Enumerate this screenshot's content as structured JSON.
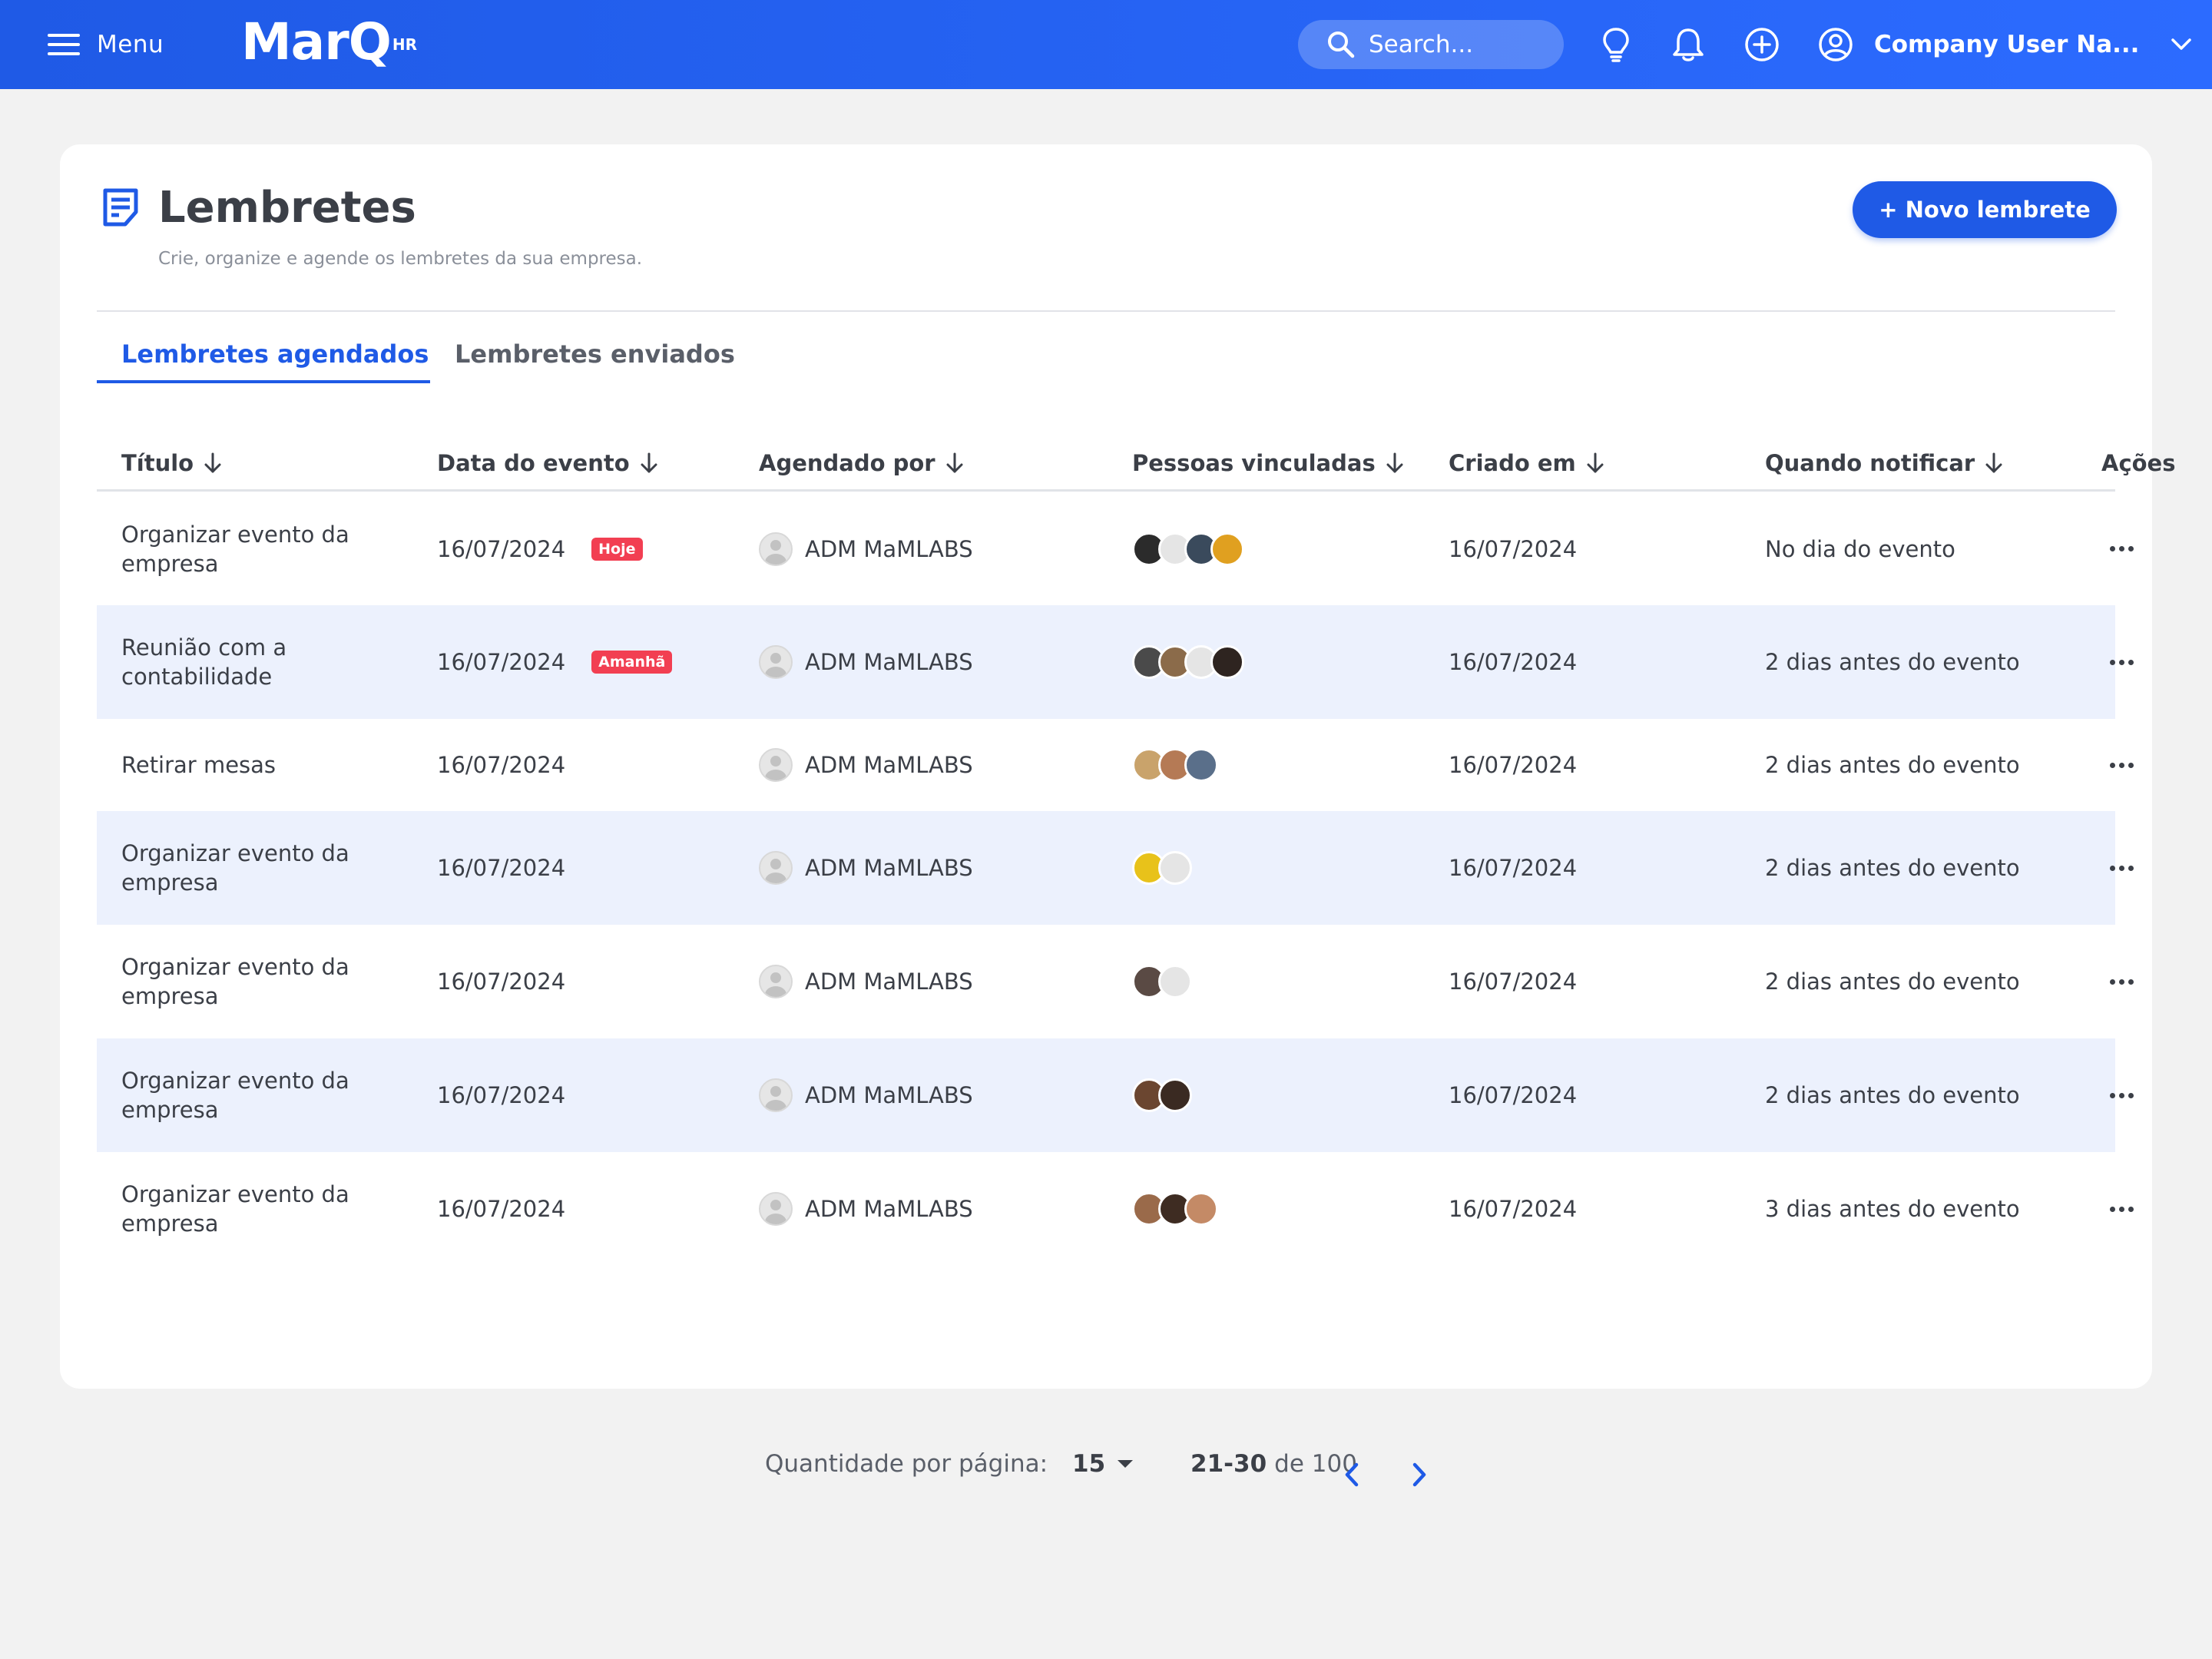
{
  "header": {
    "menu_label": "Menu",
    "logo_text": "MarQ",
    "logo_sup": "HR",
    "search_placeholder": "Search...",
    "user_name": "Company User Na..."
  },
  "page": {
    "title": "Lembretes",
    "subtitle": "Crie, organize e agende os lembretes da sua empresa.",
    "new_button": "+ Novo lembrete"
  },
  "tabs": [
    {
      "label": "Lembretes agendados",
      "active": true
    },
    {
      "label": "Lembretes enviados",
      "active": false
    }
  ],
  "table": {
    "columns": [
      "Título",
      "Data do evento",
      "Agendado por",
      "Pessoas vinculadas",
      "Criado em",
      "Quando notificar",
      "Ações"
    ],
    "rows": [
      {
        "title_1": "Organizar evento da",
        "title_2": "empresa",
        "date": "16/07/2024",
        "badge": "Hoje",
        "by": "ADM MaMLABS",
        "people": [
          "#2b2b2b",
          "#e5e5e5",
          "#3a4a5c",
          "#e0a020"
        ],
        "created": "16/07/2024",
        "notify": "No dia do evento"
      },
      {
        "title_1": "Reunião com a",
        "title_2": "contabilidade",
        "date": "16/07/2024",
        "badge": "Amanhã",
        "by": "ADM MaMLABS",
        "people": [
          "#4a4a4a",
          "#8b6b4a",
          "#e5e5e5",
          "#2e2420"
        ],
        "created": "16/07/2024",
        "notify": "2 dias antes do evento"
      },
      {
        "title_1": "Retirar mesas",
        "title_2": "",
        "date": "16/07/2024",
        "badge": "",
        "by": "ADM MaMLABS",
        "people": [
          "#c9a36b",
          "#b57a55",
          "#5a6f8a"
        ],
        "created": "16/07/2024",
        "notify": "2 dias antes do evento"
      },
      {
        "title_1": "Organizar evento da",
        "title_2": "empresa",
        "date": "16/07/2024",
        "badge": "",
        "by": "ADM MaMLABS",
        "people": [
          "#e8c21a",
          "#e5e5e5"
        ],
        "created": "16/07/2024",
        "notify": "2 dias antes do evento"
      },
      {
        "title_1": "Organizar evento da",
        "title_2": "empresa",
        "date": "16/07/2024",
        "badge": "",
        "by": "ADM MaMLABS",
        "people": [
          "#5a4a44",
          "#e5e5e5"
        ],
        "created": "16/07/2024",
        "notify": "2 dias antes do evento"
      },
      {
        "title_1": "Organizar evento da",
        "title_2": "empresa",
        "date": "16/07/2024",
        "badge": "",
        "by": "ADM MaMLABS",
        "people": [
          "#6b4630",
          "#3a2a22"
        ],
        "created": "16/07/2024",
        "notify": "2 dias antes do evento"
      },
      {
        "title_1": "Organizar evento da",
        "title_2": "empresa",
        "date": "16/07/2024",
        "badge": "",
        "by": "ADM MaMLABS",
        "people": [
          "#9a6a4a",
          "#3e2c22",
          "#c48a66"
        ],
        "created": "16/07/2024",
        "notify": "3 dias antes do evento"
      }
    ]
  },
  "pagination": {
    "per_page_label": "Quantidade por página:",
    "per_page_value": "15",
    "range_bold": "21-30",
    "range_rest": "de 100"
  },
  "colors": {
    "brand": "#1f5ae6",
    "badge_red": "#f23f52",
    "row_alt": "#ecf1fd"
  }
}
